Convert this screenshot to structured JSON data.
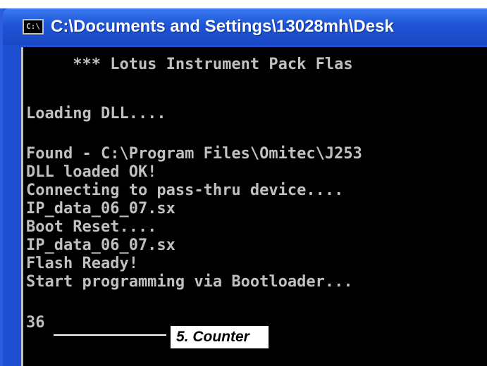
{
  "window": {
    "title": "C:\\Documents and Settings\\13028mh\\Desk",
    "icon": "cmd-icon",
    "icon_text": "C:\\"
  },
  "console": {
    "lines": [
      "     *** Lotus Instrument Pack Flas",
      "Loading DLL....",
      "Found - C:\\Program Files\\Omitec\\J253",
      "DLL loaded OK!",
      "Connecting to pass-thru device....",
      "IP_data_06_07.sx",
      "Boot Reset....",
      "IP_data_06_07.sx",
      "Flash Ready!",
      "Start programming via Bootloader...",
      "36"
    ]
  },
  "annotation": {
    "label": "5. Counter"
  },
  "colors": {
    "titlebar": "#1e54d6",
    "console_bg": "#000000",
    "console_text": "#c0c0c0"
  }
}
